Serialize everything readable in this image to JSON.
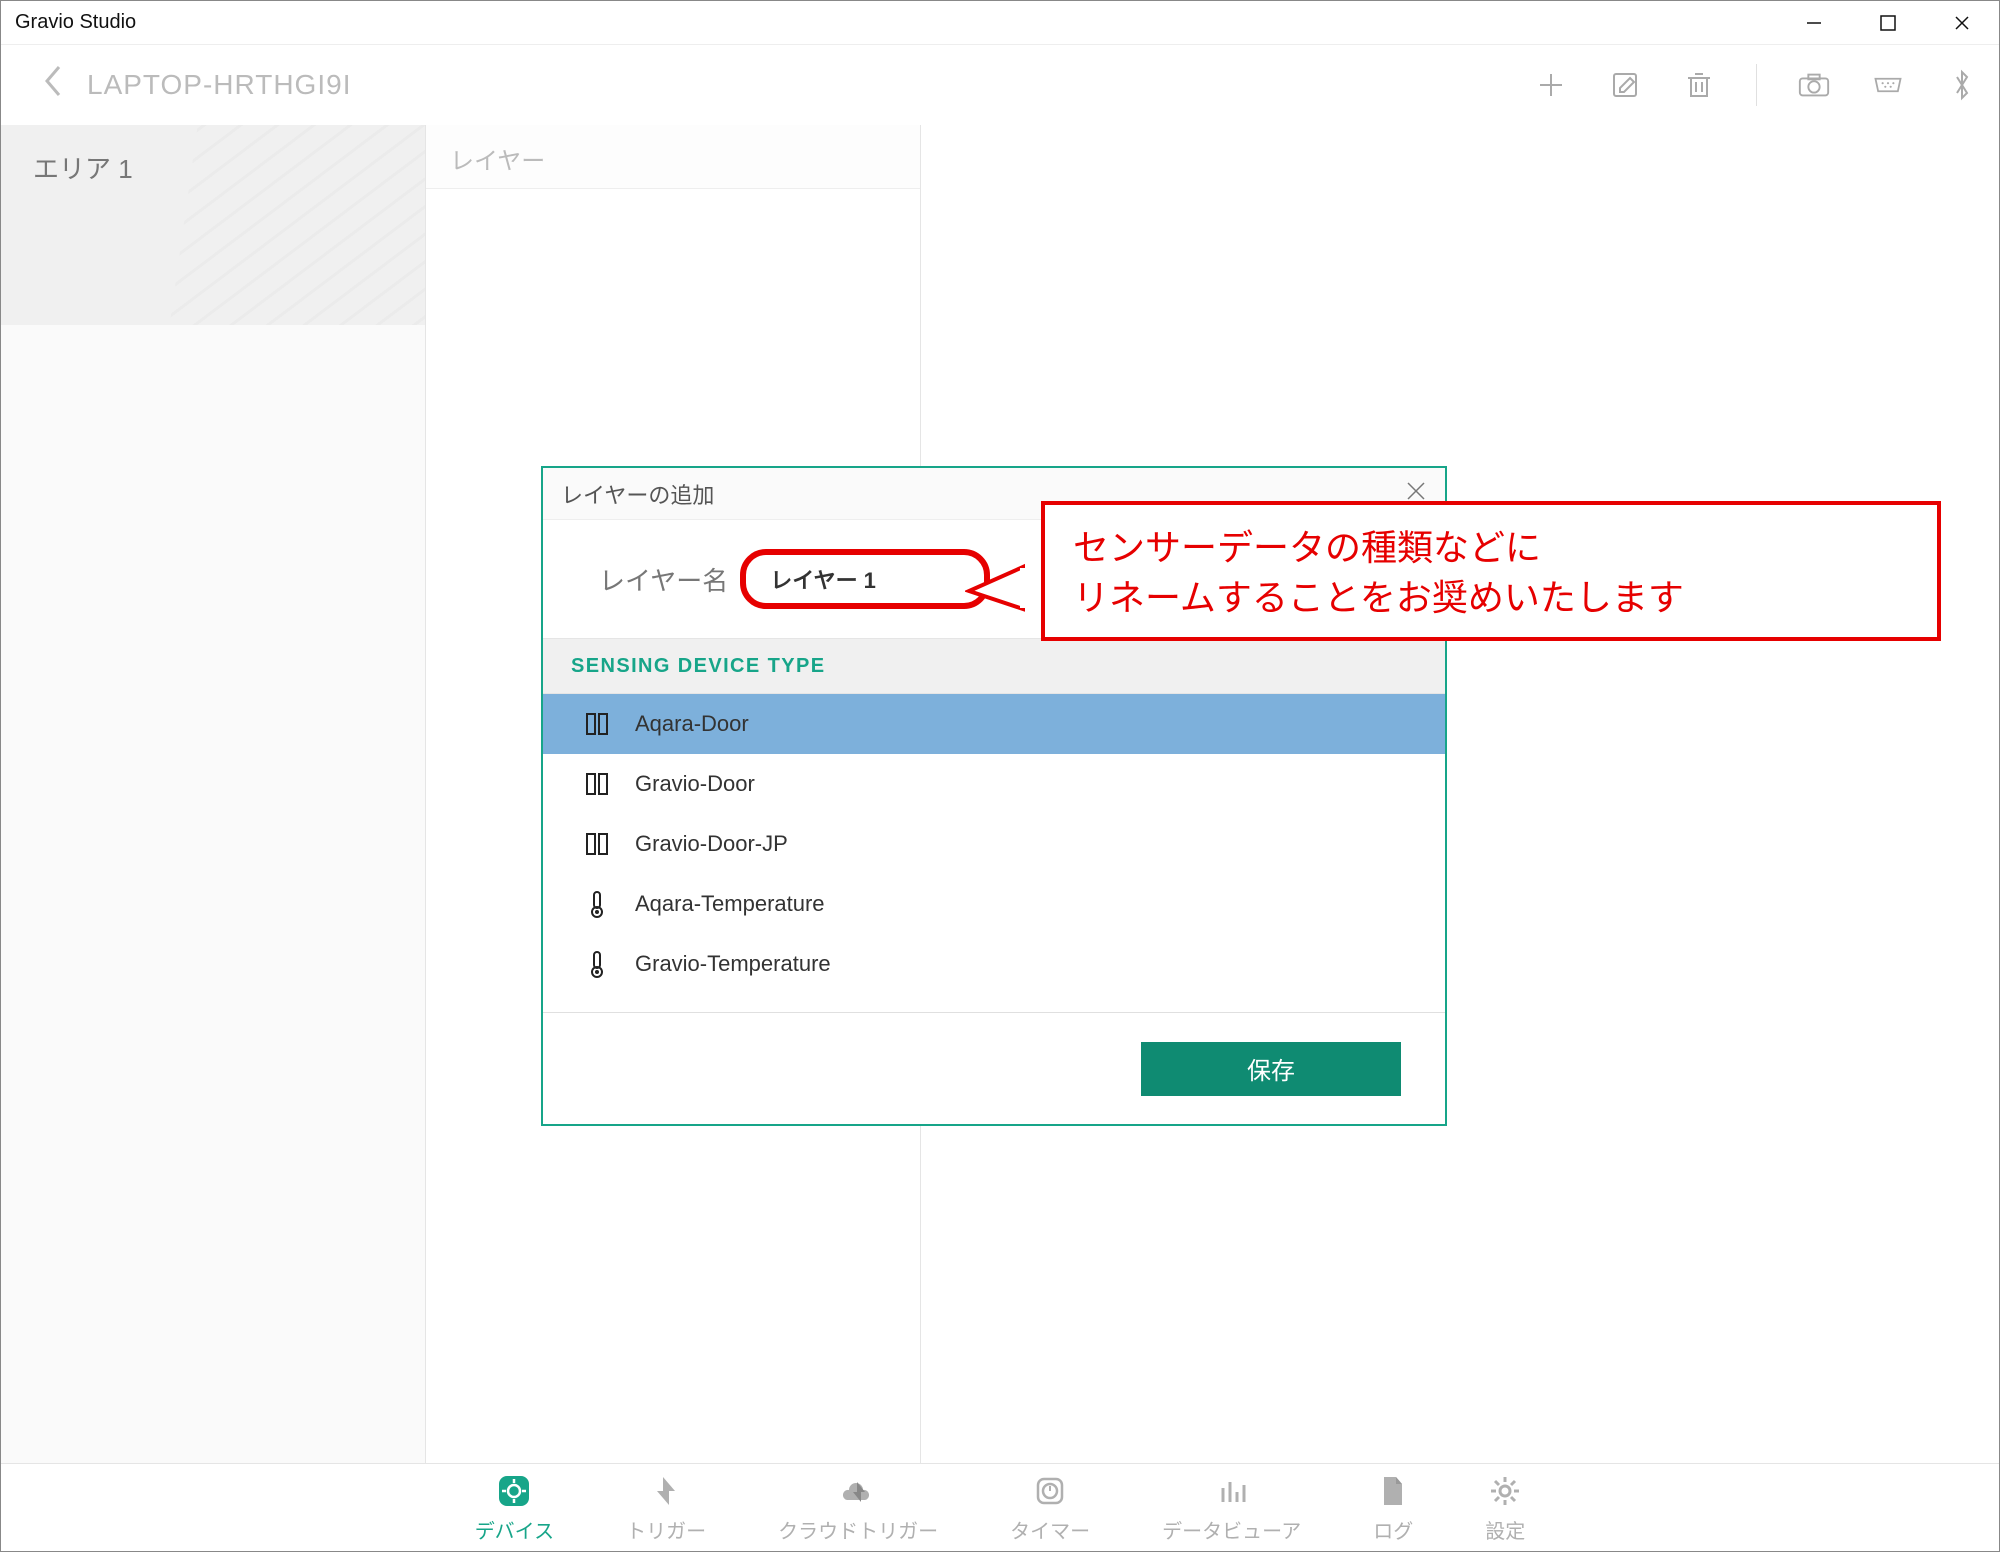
{
  "window": {
    "title": "Gravio Studio"
  },
  "header": {
    "breadcrumb": "LAPTOP-HRTHGI9I"
  },
  "area_panel": {
    "area_name": "エリア 1"
  },
  "layer_panel": {
    "header": "レイヤー"
  },
  "modal": {
    "title": "レイヤーの追加",
    "name_label": "レイヤー名",
    "name_value": "レイヤー 1",
    "section_header": "SENSING DEVICE TYPE",
    "devices": [
      {
        "label": "Aqara-Door",
        "icon": "door",
        "selected": true
      },
      {
        "label": "Gravio-Door",
        "icon": "door",
        "selected": false
      },
      {
        "label": "Gravio-Door-JP",
        "icon": "door",
        "selected": false
      },
      {
        "label": "Aqara-Temperature",
        "icon": "thermo",
        "selected": false
      },
      {
        "label": "Gravio-Temperature",
        "icon": "thermo",
        "selected": false
      }
    ],
    "save_label": "保存"
  },
  "callout": {
    "line1": "センサーデータの種類などに",
    "line2": "リネームすることをお奨めいたします"
  },
  "bottom_nav": [
    {
      "label": "デバイス",
      "icon": "gear",
      "active": true
    },
    {
      "label": "トリガー",
      "icon": "trigger",
      "active": false
    },
    {
      "label": "クラウドトリガー",
      "icon": "cloud-trigger",
      "active": false
    },
    {
      "label": "タイマー",
      "icon": "timer",
      "active": false
    },
    {
      "label": "データビューア",
      "icon": "bars",
      "active": false
    },
    {
      "label": "ログ",
      "icon": "doc",
      "active": false
    },
    {
      "label": "設定",
      "icon": "settings",
      "active": false
    }
  ]
}
